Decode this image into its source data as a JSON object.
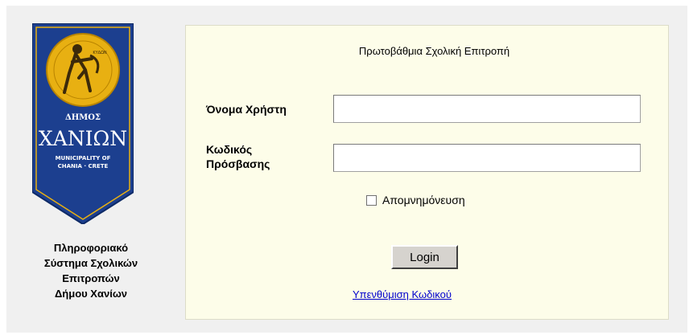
{
  "branding": {
    "logo_text_top": "ΔΗΜΟΣ",
    "logo_text_main": "ΧΑΝΙΩΝ",
    "logo_text_en_line1": "MUNICIPALITY OF",
    "logo_text_en_line2": "CHANIA · CRETE",
    "logo_ring_text": "ΚΥΔΩΝ",
    "colors": {
      "banner_blue": "#1c3f8f",
      "banner_gold": "#e8b012"
    }
  },
  "system_title": {
    "line1": "Πληροφοριακό",
    "line2": "Σύστημα Σχολικών",
    "line3": "Επιτροπών",
    "line4": "Δήμου Χανίων"
  },
  "login": {
    "title": "Πρωτοβάθμια Σχολική Επιτροπή",
    "username_label": "Όνομα Χρήστη",
    "username_value": "",
    "password_label_line1": "Κωδικός",
    "password_label_line2": "Πρόσβασης",
    "password_value": "",
    "remember_label": "Απομνημόνευση",
    "remember_checked": false,
    "login_button": "Login",
    "reminder_link": "Υπενθύμιση Κωδικού"
  },
  "colors": {
    "panel_background": "#fdfde9",
    "page_background": "#f0f0f0",
    "link": "#0000cc"
  }
}
